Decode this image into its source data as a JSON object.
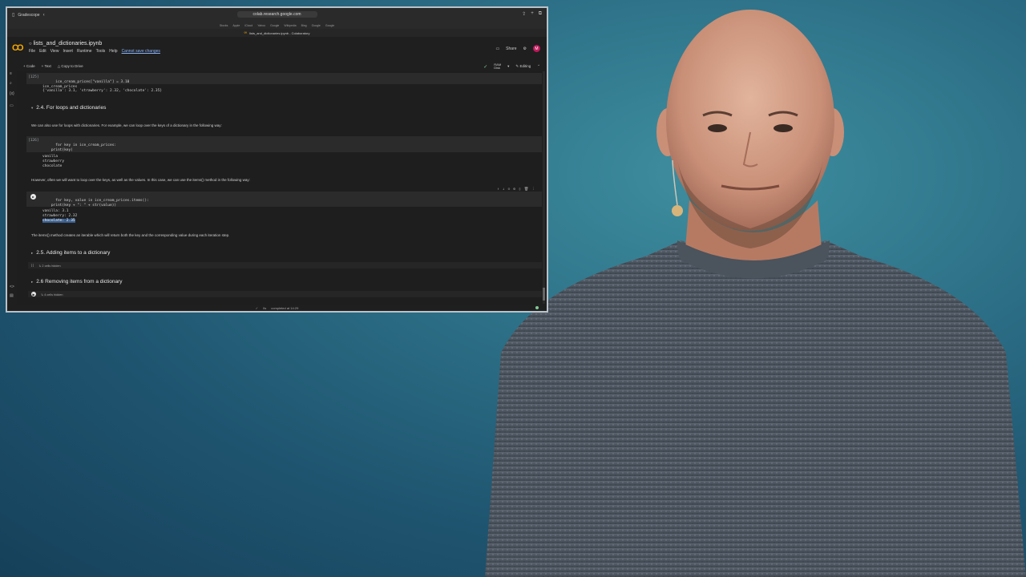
{
  "browser": {
    "profile_tab": "Gradescope",
    "url": "colab.research.google.com",
    "bookmarks": [
      "Stocks",
      "Apple",
      "iCloud",
      "Yahoo",
      "Google",
      "Wikipedia",
      "Bing",
      "Google",
      "Google"
    ],
    "tab_title": "lists_and_dictionaries.ipynb - Colaboratory"
  },
  "colab": {
    "logo": "CO",
    "notebook_title": "lists_and_dictionaries.ipynb",
    "menu": [
      "File",
      "Edit",
      "View",
      "Insert",
      "Runtime",
      "Tools",
      "Help"
    ],
    "unsaved_notice": "Cannot save changes",
    "share": "Share",
    "avatar": "M",
    "add_code": "+ Code",
    "add_text": "+ Text",
    "copy_drive": "Copy to Drive",
    "ram_label": "RAM",
    "disk_label": "Disk",
    "editing": "Editing"
  },
  "cells": {
    "c125_exec": "[125]",
    "c125_code": "ice_cream_prices[\"vanilla\"] = 3.10\nice_cream_prices",
    "c125_out": "{'vanilla': 3.1, 'strawberry': 2.32, 'chocolate': 2.35}",
    "h24": "2.4. For loops and dictionaries",
    "p1": "We can also use for loops with dictionaries. For example, we can loop over the keys of a dictionary in the following way:",
    "c126_exec": "[126]",
    "c126_code": "for key in ice_cream_prices:\n    print(key)",
    "c126_out": "vanilla\nstrawberry\nchocolate",
    "p2": "However, often we will want to loop over the keys, as well as the values. In this case, we can use the items() method in the following way:",
    "c127_code": "for key, value in ice_cream_prices.items():\n    print(key + \": \" + str(value))",
    "c127_out_1": "vanilla: 3.1\nstrawberry: 2.32\n",
    "c127_out_hl": "chocolate: 2.35",
    "p3": "The items() method creates an iterable which will return both the key and the corresponding value during each iteration step.",
    "h25": "2.5. Adding items to a dictionary",
    "hidden25": "↳ 2 cells hidden",
    "h26": "2.6 Removing items from a dictionary",
    "hidden26": "↳ 4 cells hidden",
    "empty_exec": "[ ]"
  },
  "status": {
    "time": "0s",
    "completed": "completed at 14:29"
  }
}
